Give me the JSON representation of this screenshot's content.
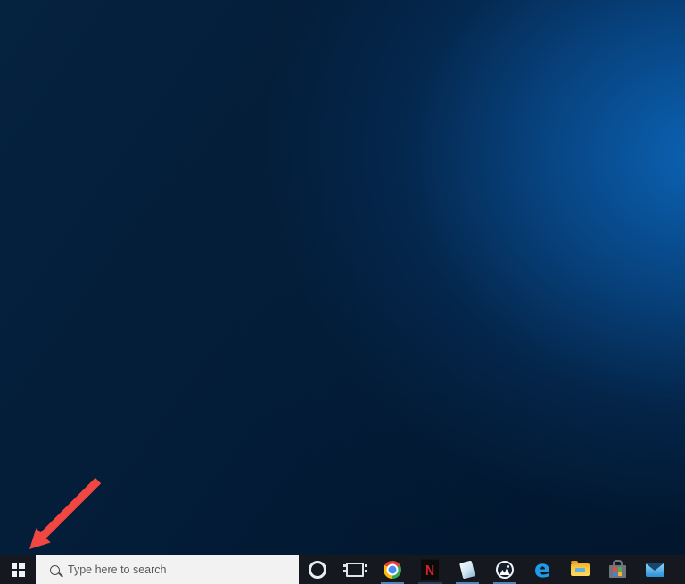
{
  "annotation": {
    "arrow_color": "#f04743",
    "target": "start-button"
  },
  "wallpaper": {
    "glow_color": "#0b63b5",
    "base_color": "#031b36"
  },
  "taskbar": {
    "background_color": "#15191f",
    "indicator_color": "#4f84bd",
    "search_box_color": "#f2f2f2",
    "start_button": {
      "label": "Start"
    },
    "search": {
      "placeholder": "Type here to search"
    },
    "system_buttons": [
      {
        "id": "cortana",
        "label": "Cortana"
      },
      {
        "id": "task-view",
        "label": "Task View"
      }
    ],
    "pinned_apps": [
      {
        "id": "chrome",
        "label": "Google Chrome",
        "running": true
      },
      {
        "id": "netflix",
        "label": "Netflix",
        "running": true,
        "dim_indicator": true,
        "glyph": "N"
      },
      {
        "id": "notepad",
        "label": "Notepad",
        "running": true
      },
      {
        "id": "photos",
        "label": "Photos",
        "running": true
      },
      {
        "id": "edge",
        "label": "Microsoft Edge",
        "running": false,
        "glyph": "e"
      },
      {
        "id": "file-explorer",
        "label": "File Explorer",
        "running": false
      },
      {
        "id": "store",
        "label": "Microsoft Store",
        "running": false
      },
      {
        "id": "mail",
        "label": "Mail",
        "running": false
      }
    ]
  }
}
